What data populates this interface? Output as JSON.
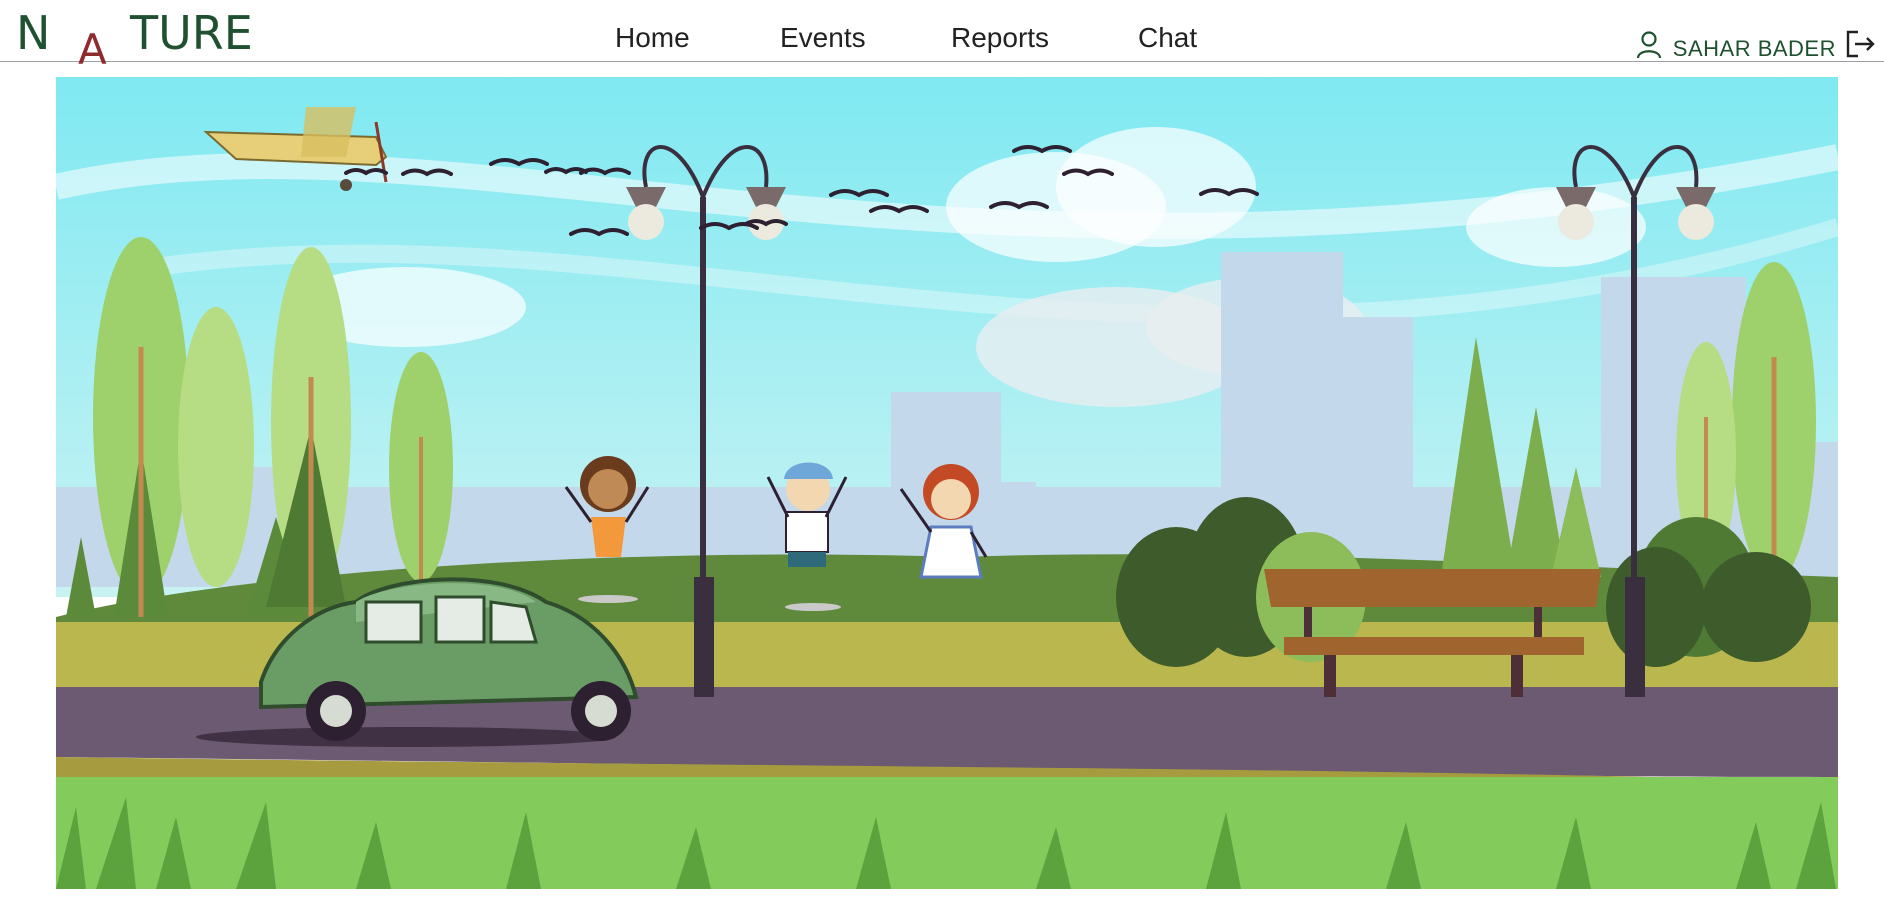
{
  "app": {
    "logo": {
      "part1": "N",
      "part2": "A",
      "part3": "TURE"
    }
  },
  "nav": {
    "items": [
      {
        "label": "Home"
      },
      {
        "label": "Events"
      },
      {
        "label": "Reports"
      },
      {
        "label": "Chat"
      }
    ]
  },
  "user": {
    "name": "SAHAR BADER",
    "user_icon": "user-icon",
    "logout_icon": "logout-icon"
  },
  "hero": {
    "scene": "cartoon-park-illustration"
  },
  "colors": {
    "brand_green": "#1f5130",
    "brand_red": "#8f2a2f",
    "sky": "#8eeaf0",
    "road": "#6b5a72"
  }
}
